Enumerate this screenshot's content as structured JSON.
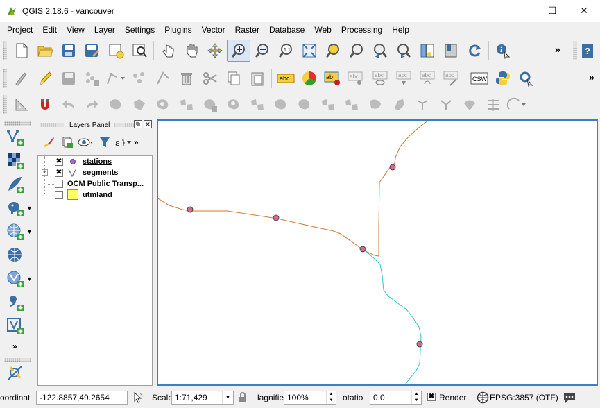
{
  "window": {
    "title": "QGIS 2.18.6 - vancouver",
    "minimize": "—",
    "maximize": "☐",
    "close": "✕"
  },
  "menu": [
    "Project",
    "Edit",
    "View",
    "Layer",
    "Settings",
    "Plugins",
    "Vector",
    "Raster",
    "Database",
    "Web",
    "Processing",
    "Help"
  ],
  "toolbar_overflow": "»",
  "layers_panel": {
    "title": "Layers Panel",
    "float_icon": "⧉",
    "close_icon": "✕",
    "overflow": "»",
    "layers": [
      {
        "name": "stations",
        "checked": true,
        "checkbox_mark": "✖",
        "underlined": true,
        "icon": "point-layer-icon",
        "color": "#a06cc8"
      },
      {
        "name": "segments",
        "checked": true,
        "checkbox_mark": "✖",
        "underlined": false,
        "icon": "line-layer-icon",
        "expander": "+"
      },
      {
        "name": "OCM Public Transp...",
        "checked": false,
        "checkbox_mark": "",
        "underlined": false,
        "icon": "none"
      },
      {
        "name": "utmland",
        "checked": false,
        "checkbox_mark": "",
        "underlined": false,
        "icon": "polygon-layer-icon",
        "color": "#ffff66"
      }
    ]
  },
  "map": {
    "line_colors": {
      "orange": "#d2772f",
      "cyan": "#2cc8c8"
    },
    "station_color": "#d46a8c",
    "border_color": "#3c7fc6"
  },
  "statusbar": {
    "coordinate_label": "oordinat",
    "coordinate_value": "-122.8857,49.2654",
    "scale_label": "Scale",
    "scale_value": "1:71,429",
    "magnifier_label": "lagnifie",
    "magnifier_value": "100%",
    "rotation_label": "otatio",
    "rotation_value": "0.0",
    "render_label": "Render",
    "render_checked_mark": "✖",
    "crs_label": "EPSG:3857 (OTF)"
  },
  "left_toolbar_overflow": "»"
}
